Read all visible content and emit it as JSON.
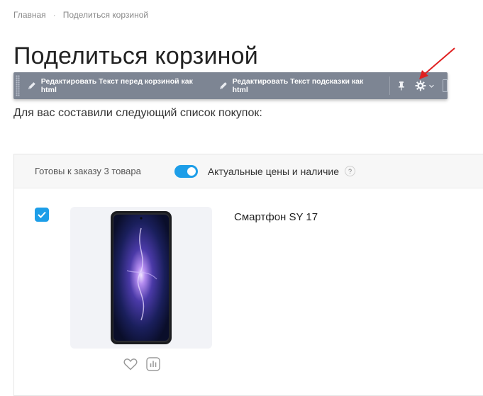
{
  "breadcrumb": {
    "home": "Главная",
    "separator": "·",
    "current": "Поделиться корзиной"
  },
  "page_title": "Поделиться корзиной",
  "toolbar": {
    "edit_before_cart": "Редактировать Текст перед корзиной как html",
    "edit_hint": "Редактировать Текст подсказки как html"
  },
  "subtitle": "Для вас составили следующий список покупок:",
  "cart_panel": {
    "ready_count": "Готовы к заказу 3 товара",
    "actual_prices_label": "Актуальные цены и наличие",
    "actual_prices_enabled": true,
    "help_glyph": "?"
  },
  "product": {
    "name": "Смартфон SY 17",
    "selected": true
  },
  "colors": {
    "accent": "#1d9ee8",
    "toolbar_bg": "#7d8593",
    "arrow": "#e02020"
  }
}
